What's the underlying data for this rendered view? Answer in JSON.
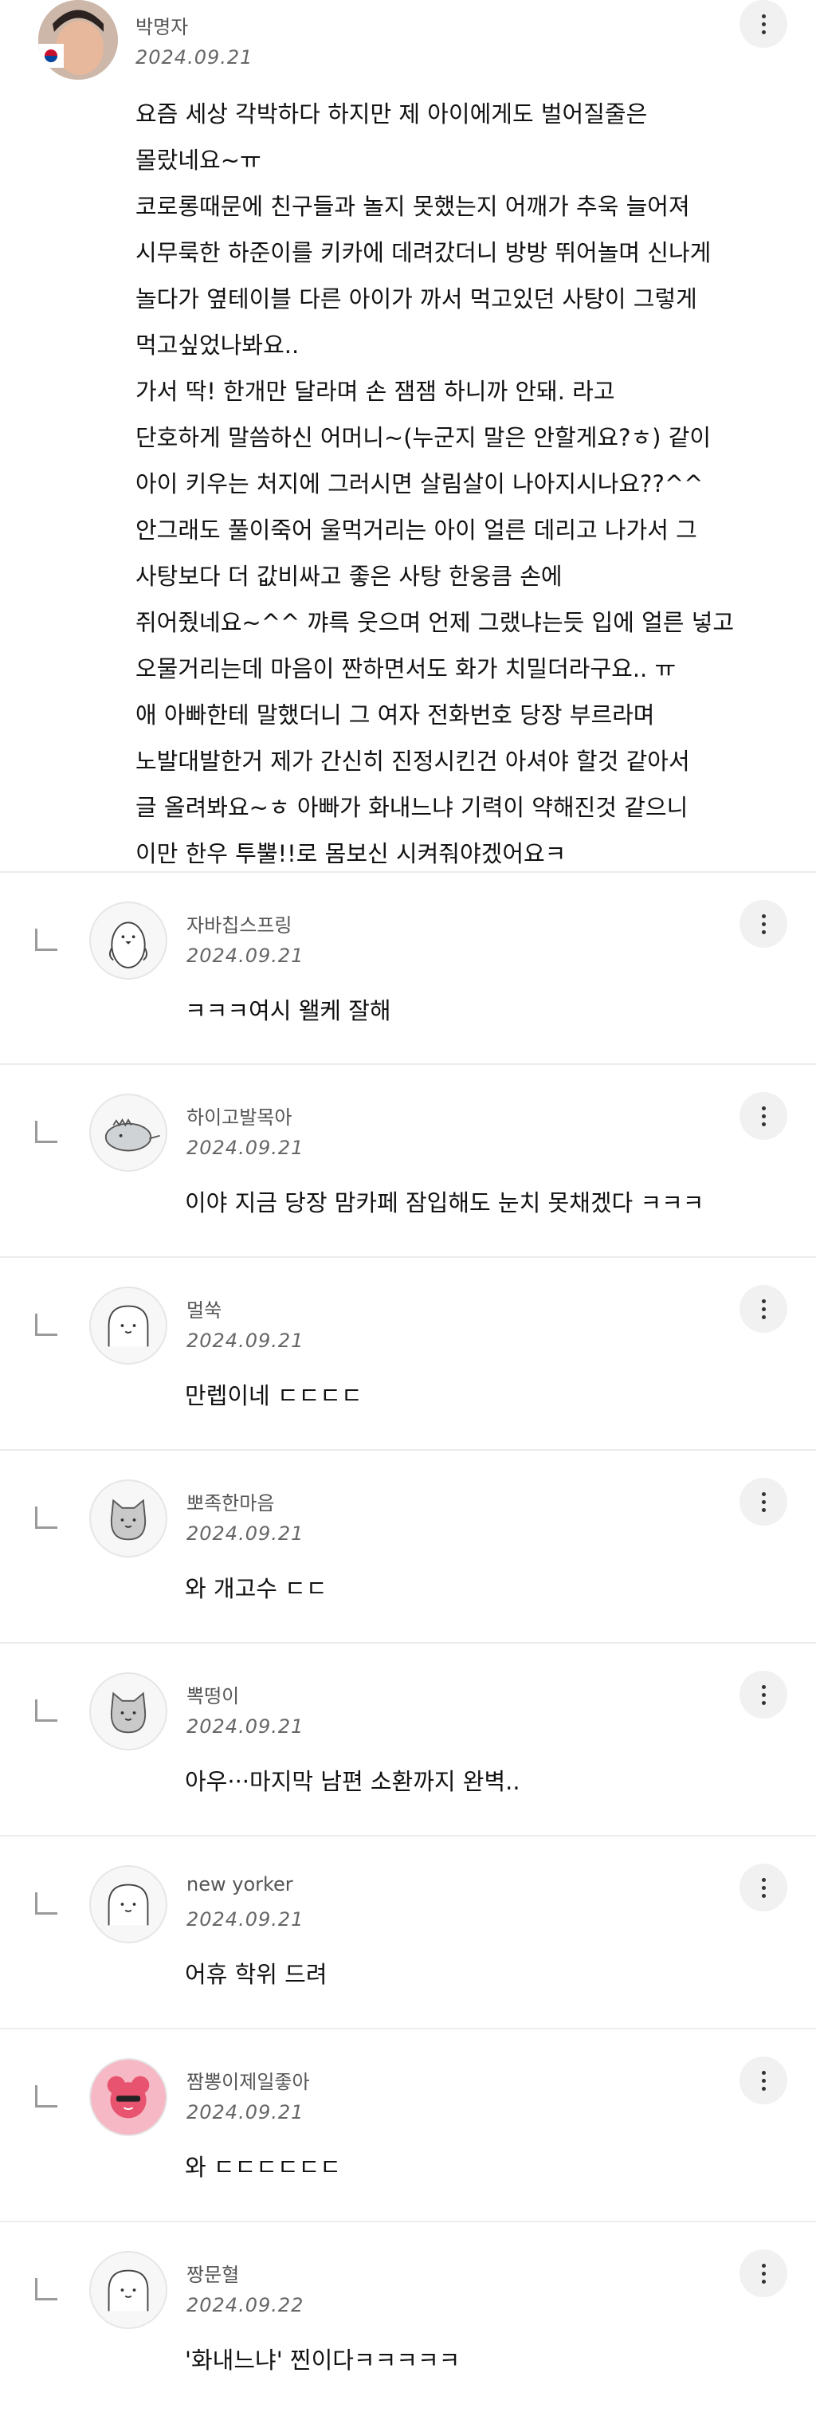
{
  "post": {
    "author": "박명자",
    "date": "2024.09.21",
    "lines": [
      "요즘 세상 각박하다 하지만 제 아이에게도 벌어질줄은",
      "몰랐네요~ㅠ",
      "코로롱때문에 친구들과 놀지 못했는지 어깨가 추욱 늘어져",
      "시무룩한 하준이를 키카에 데려갔더니 방방 뛰어놀며 신나게",
      "놀다가 옆테이블 다른 아이가 까서 먹고있던 사탕이 그렇게",
      "먹고싶었나봐요..",
      "가서 딱! 한개만 달라며 손 잼잼 하니까 안돼. 라고",
      "단호하게 말씀하신 어머니~(누군지 말은 안할게요?ㅎ) 같이",
      "아이 키우는 처지에 그러시면 살림살이 나아지시나요??^^",
      "안그래도 풀이죽어 울먹거리는 아이 얼른 데리고 나가서 그",
      "사탕보다 더 값비싸고 좋은 사탕 한웅큼 손에",
      "쥐어줬네요~^^ 꺄륵 웃으며 언제 그랬냐는듯 입에 얼른 넣고",
      "오물거리는데 마음이 짠하면서도 화가 치밀더라구요.. ㅠ",
      "애 아빠한테 말했더니 그 여자 전화번호 당장 부르라며",
      "노발대발한거 제가 간신히 진정시킨건 아셔야 할것 같아서",
      "글 올려봐요~ㅎ 아빠가 화내느냐 기력이 약해진것 같으니",
      "이만 한우 투뿔!!로 몸보신 시켜줘야겠어요ㅋ"
    ]
  },
  "replies": [
    {
      "author": "자바칩스프링",
      "date": "2024.09.21",
      "text": "ㅋㅋㅋ여시 왤케 잘해",
      "avatar_icon": "penguin-icon"
    },
    {
      "author": "하이고발목아",
      "date": "2024.09.21",
      "text": "이야 지금 당장 맘카페 잠입해도 눈치 못채겠다 ㅋㅋㅋ",
      "avatar_icon": "dinosaur-icon"
    },
    {
      "author": "멀쑥",
      "date": "2024.09.21",
      "text": "만렙이네 ㄷㄷㄷㄷ",
      "avatar_icon": "ghost-icon"
    },
    {
      "author": "뽀족한마음",
      "date": "2024.09.21",
      "text": "와 개고수 ㄷㄷ",
      "avatar_icon": "cat-icon"
    },
    {
      "author": "뽁떵이",
      "date": "2024.09.21",
      "text": "아우···마지막 남편 소환까지 완벽..",
      "avatar_icon": "cat-icon"
    },
    {
      "author": "new yorker",
      "date": "2024.09.21",
      "text": "어휴 학위 드려",
      "avatar_icon": "ghost-icon"
    },
    {
      "author": "짬뽕이제일좋아",
      "date": "2024.09.21",
      "text": "와 ㄷㄷㄷㄷㄷㄷ",
      "avatar_icon": "pink-character-icon"
    },
    {
      "author": "짱문혈",
      "date": "2024.09.22",
      "text": "'화내느냐' 찐이다ㅋㅋㅋㅋㅋ",
      "avatar_icon": "ghost-icon"
    }
  ],
  "colors": {
    "background": "#ffffff",
    "divider": "#ececec",
    "meta_text": "#666666",
    "button_bg": "#f1f1f1"
  }
}
